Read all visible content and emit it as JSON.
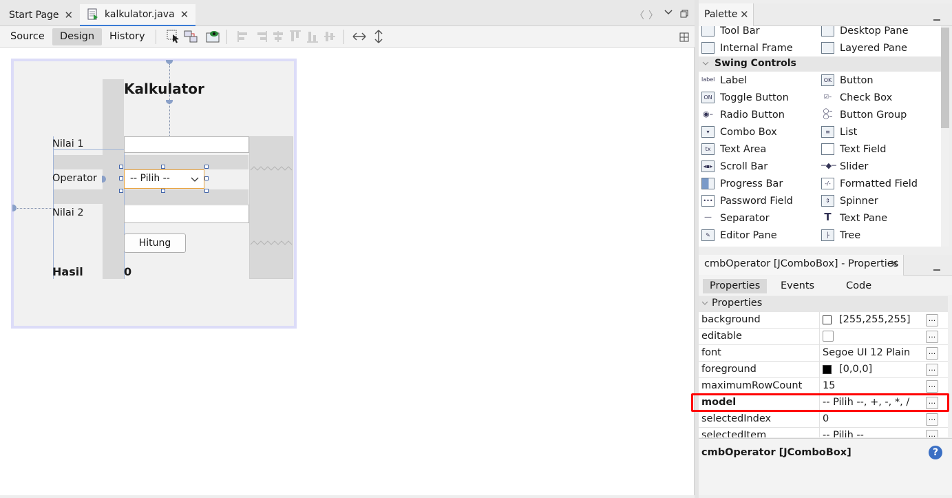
{
  "editor": {
    "tabs": [
      {
        "label": "Start Page",
        "active": false
      },
      {
        "label": "kalkulator.java",
        "active": true
      }
    ],
    "views": [
      "Source",
      "Design",
      "History"
    ],
    "selected_view": "Design"
  },
  "form": {
    "title": "Kalkulator",
    "label_nilai1": "Nilai 1",
    "label_operator": "Operator",
    "label_nilai2": "Nilai 2",
    "combo_value": "-- Pilih --",
    "button_label": "Hitung",
    "hasil_label": "Hasil",
    "hasil_value": "0"
  },
  "palette": {
    "title": "Palette",
    "section": "Swing Controls",
    "top_items": [
      [
        "Tool Bar",
        "Desktop Pane"
      ],
      [
        "Internal Frame",
        "Layered Pane"
      ]
    ],
    "items": [
      [
        "Label",
        "Button"
      ],
      [
        "Toggle Button",
        "Check Box"
      ],
      [
        "Radio Button",
        "Button Group"
      ],
      [
        "Combo Box",
        "List"
      ],
      [
        "Text Area",
        "Text Field"
      ],
      [
        "Scroll Bar",
        "Slider"
      ],
      [
        "Progress Bar",
        "Formatted Field"
      ],
      [
        "Password Field",
        "Spinner"
      ],
      [
        "Separator",
        "Text Pane"
      ],
      [
        "Editor Pane",
        "Tree"
      ]
    ],
    "icon_texts": {
      "label": "label",
      "button": "OK",
      "toggle": "ON",
      "textarea": "tx"
    }
  },
  "properties": {
    "title": "cmbOperator [JComboBox] - Properties",
    "tabs": [
      "Properties",
      "Events",
      "Code"
    ],
    "selected_tab": "Properties",
    "section": "Properties",
    "rows": [
      {
        "name": "background",
        "value": "[255,255,255]",
        "swatch": "#ffffff"
      },
      {
        "name": "editable",
        "value": ""
      },
      {
        "name": "font",
        "value": "Segoe UI 12 Plain"
      },
      {
        "name": "foreground",
        "value": "[0,0,0]",
        "swatch": "#000000"
      },
      {
        "name": "maximumRowCount",
        "value": "15"
      },
      {
        "name": "model",
        "value": "-- Pilih --, +, -, *, /",
        "bold": true,
        "highlighted": true
      },
      {
        "name": "selectedIndex",
        "value": "0"
      },
      {
        "name": "selectedItem",
        "value": "-- Pilih --"
      }
    ],
    "dots_label": "...",
    "info_title": "cmbOperator [JComboBox]",
    "help_glyph": "?",
    "highlight_color": "#ff0000"
  }
}
